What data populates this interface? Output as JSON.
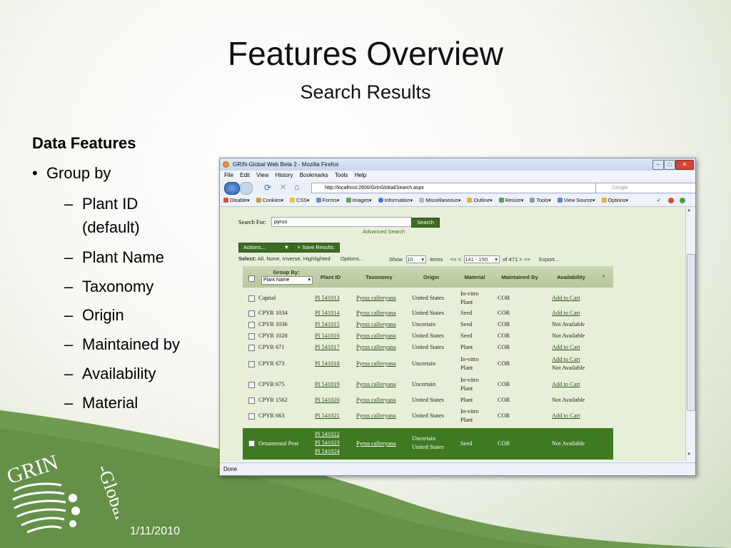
{
  "slide": {
    "title": "Features Overview",
    "subtitle": "Search Results",
    "heading": "Data Features",
    "bullet": "Group by",
    "sub_items": [
      "Plant ID",
      "(default)",
      "Plant Name",
      "Taxonomy",
      "Origin",
      "Maintained by",
      "Availability",
      "Material"
    ],
    "date": "1/11/2010",
    "logo_text": "GRIN-Global"
  },
  "browser": {
    "window_title": "GRIN-Global Web Beta 2 - Mozilla Firefox",
    "menu": [
      "File",
      "Edit",
      "View",
      "History",
      "Bookmarks",
      "Tools",
      "Help"
    ],
    "url": "http://localhost:2600/GrinGlobal/Search.aspx",
    "search_placeholder": "Google",
    "toolbar": [
      "Disable▾",
      "Cookies▾",
      "CSS▾",
      "Forms▾",
      "Images▾",
      "Information▾",
      "Miscellaneous▾",
      "Outline▾",
      "Resize▾",
      "Tools▾",
      "View Source▾",
      "Options▾"
    ],
    "status": "Done"
  },
  "page": {
    "search_label": "Search For:",
    "search_value": "pyrus",
    "search_button": "Search",
    "advanced_search": "Advanced Search",
    "actions_button": "Actions...",
    "save_results_button": "Save Results",
    "select_label": "Select:",
    "select_options": "All, None, Inverse, Highlighted",
    "options_link": "Options...",
    "show_label": "Show",
    "show_value": "10",
    "items_label": "items",
    "prev_nav": "<< <",
    "range_value": "141 - 150",
    "of_total": "of 471 > >>",
    "export_link": "Export...",
    "group_by_label": "Group By:",
    "group_by_value": "Plant Name",
    "columns": [
      "Plant ID",
      "Taxonomy",
      "Origin",
      "Material",
      "Maintained By",
      "Availability"
    ],
    "rows": [
      {
        "name": "Capital",
        "id": "PI 541013",
        "taxonomy": "Pyrus calleryana",
        "origin": "United States",
        "material": "In-vitro Plant",
        "maintained": "COR",
        "availability": "Add to Cart"
      },
      {
        "name": "CPYR 1034",
        "id": "PI 541014",
        "taxonomy": "Pyrus calleryana",
        "origin": "United States",
        "material": "Seed",
        "maintained": "COR",
        "availability": "Add to Cart"
      },
      {
        "name": "CPYR 1036",
        "id": "PI 541015",
        "taxonomy": "Pyrus calleryana",
        "origin": "Uncertain",
        "material": "Seed",
        "maintained": "COR",
        "availability": "Not Available"
      },
      {
        "name": "CPYR 1028",
        "id": "PI 541016",
        "taxonomy": "Pyrus calleryana",
        "origin": "United States",
        "material": "Seed",
        "maintained": "COR",
        "availability": "Not Available"
      },
      {
        "name": "CPYR 671",
        "id": "PI 541017",
        "taxonomy": "Pyrus calleryana",
        "origin": "United States",
        "material": "Plant",
        "maintained": "COR",
        "availability": "Add to Cart"
      },
      {
        "name": "CPYR 673",
        "id": "PI 541018",
        "taxonomy": "Pyrus calleryana",
        "origin": "Uncertain",
        "material": "In-vitro Plant",
        "maintained": "COR",
        "availability": "Add to Cart",
        "availability2": "Not Available"
      },
      {
        "name": "CPYR 675",
        "id": "PI 541019",
        "taxonomy": "Pyrus calleryana",
        "origin": "Uncertain",
        "material": "In-vitro Plant",
        "maintained": "COR",
        "availability": "Add to Cart"
      },
      {
        "name": "CPYR 1562",
        "id": "PI 541020",
        "taxonomy": "Pyrus calleryana",
        "origin": "United States",
        "material": "Plant",
        "maintained": "COR",
        "availability": "Not Available"
      },
      {
        "name": "CPYR 663",
        "id": "PI 541021",
        "taxonomy": "Pyrus calleryana",
        "origin": "United States",
        "material": "In-vitro Plant",
        "maintained": "COR",
        "availability": "Add to Cart"
      }
    ],
    "group_row": {
      "name": "Ornamental Pear",
      "ids": [
        "PI 541022",
        "PI 541023",
        "PI 541024"
      ],
      "taxonomy": "Pyrus calleryana",
      "origins": [
        "Uncertain",
        "United States"
      ],
      "material": "Seed",
      "maintained": "COR",
      "availability": "Not Available"
    }
  },
  "colors": {
    "slide_green": "#6f9a50",
    "page_bg": "#e7efd9",
    "button_green": "#3d6b24"
  }
}
